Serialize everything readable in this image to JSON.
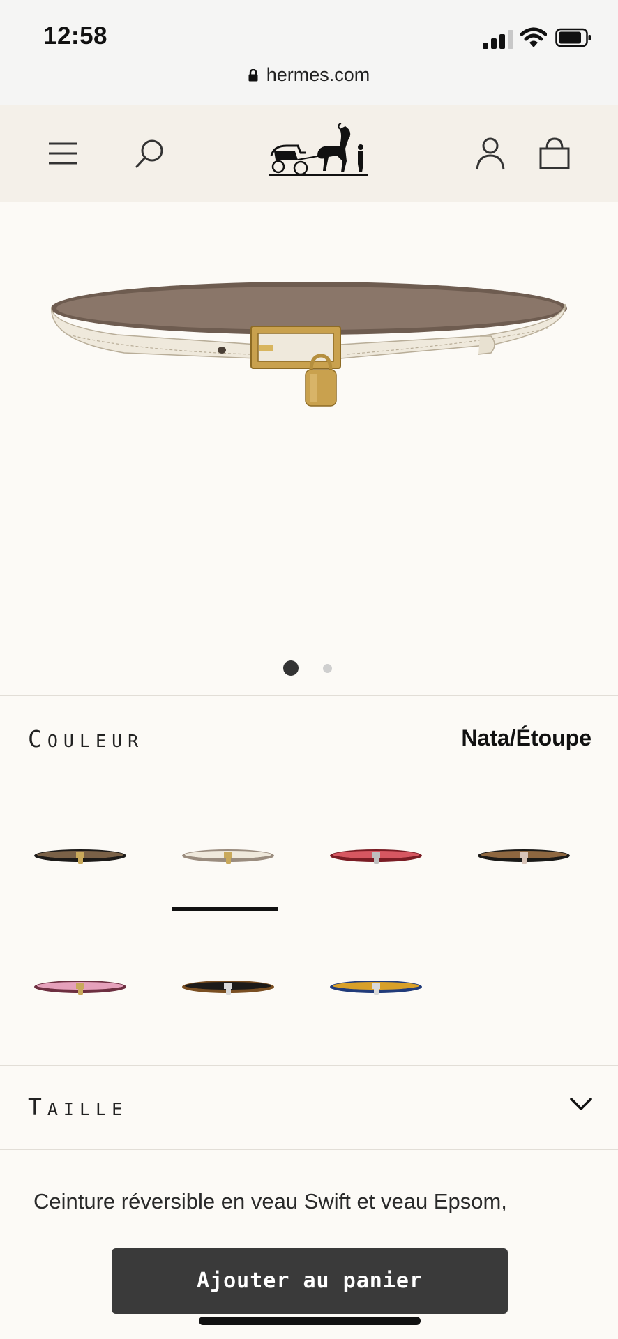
{
  "status_bar": {
    "time": "12:58",
    "icons": [
      "cellular-signal-icon",
      "wifi-icon",
      "battery-icon"
    ]
  },
  "browser": {
    "url": "hermes.com",
    "icon": "lock-icon"
  },
  "header": {
    "icons": [
      "menu-icon",
      "search-icon",
      "account-icon",
      "shopping-bag-icon"
    ]
  },
  "product": {
    "image_icon": "belt-with-padlock",
    "gallery": {
      "current": 1,
      "total": 2
    },
    "color_label_first": "C",
    "color_label_rest": "OULEUR",
    "selected_color": "Nata/Étoupe",
    "swatches": [
      {
        "outer": "#1d1b19",
        "inner": "#7a6147",
        "hardware": "#c9a95b",
        "selected": false
      },
      {
        "outer": "#9a8c7e",
        "inner": "#efe9dc",
        "hardware": "#c9a95b",
        "selected": true
      },
      {
        "outer": "#7a1c24",
        "inner": "#d65761",
        "hardware": "#bfbfbf",
        "selected": false
      },
      {
        "outer": "#1b1a18",
        "inner": "#8e6740",
        "hardware": "#d8c4b8",
        "selected": false
      },
      {
        "outer": "#6d2f40",
        "inner": "#e5a1bb",
        "hardware": "#c9a95b",
        "selected": false
      },
      {
        "outer": "#7a4f22",
        "inner": "#1d1b19",
        "hardware": "#d9d9d9",
        "selected": false
      },
      {
        "outer": "#213b7a",
        "inner": "#d8a029",
        "hardware": "#d9d9d9",
        "selected": false
      }
    ],
    "size_label_first": "T",
    "size_label_rest": "AILLE",
    "description": "Ceinture réversible en veau Swift et veau Epsom,",
    "add_to_cart_label": "Ajouter au panier"
  }
}
